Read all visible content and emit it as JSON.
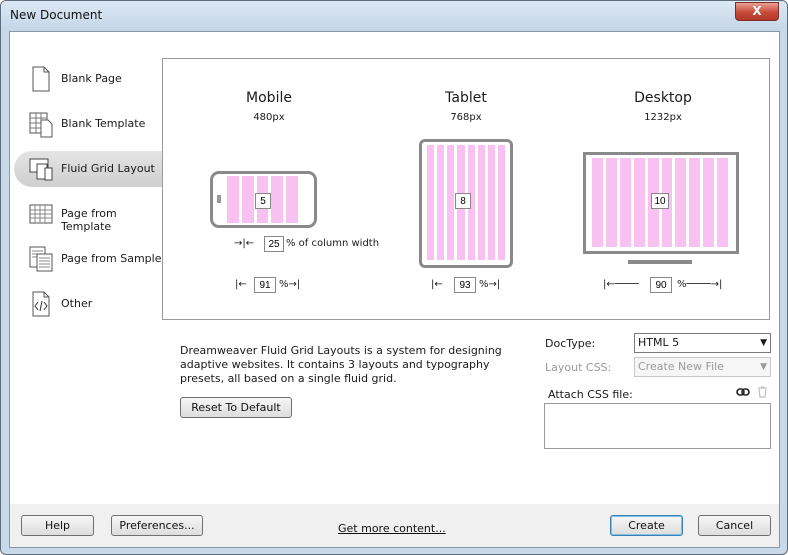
{
  "window": {
    "title": "New Document",
    "close_glyph": "X"
  },
  "sidebar": {
    "items": [
      {
        "label": "Blank Page",
        "icon": "blank-page-icon"
      },
      {
        "label": "Blank Template",
        "icon": "blank-template-icon"
      },
      {
        "label": "Fluid Grid Layout",
        "icon": "fluid-grid-icon",
        "selected": true
      },
      {
        "label": "Page from Template",
        "icon": "page-from-template-icon"
      },
      {
        "label": "Page from Sample",
        "icon": "page-from-sample-icon"
      },
      {
        "label": "Other",
        "icon": "other-code-icon"
      }
    ]
  },
  "preview": {
    "mobile": {
      "name": "Mobile",
      "px": "480px",
      "columns": "5",
      "width_pct": "91",
      "gutter_pct": "25",
      "gutter_label": "% of column width"
    },
    "tablet": {
      "name": "Tablet",
      "px": "768px",
      "columns": "8",
      "width_pct": "93"
    },
    "desktop": {
      "name": "Desktop",
      "px": "1232px",
      "columns": "10",
      "width_pct": "90"
    },
    "pct_sign": "%",
    "column_color": "#f9c0f2"
  },
  "description": "Dreamweaver Fluid Grid Layouts is a system for designing adaptive websites. It contains 3 layouts and typography presets, all based on a single fluid grid.",
  "reset_button": "Reset To Default",
  "form": {
    "doctype_label": "DocType:",
    "doctype_value": "HTML 5",
    "layout_css_label": "Layout CSS:",
    "layout_css_value": "Create New File",
    "attach_css_label": "Attach CSS file:"
  },
  "footer": {
    "help": "Help",
    "preferences": "Preferences...",
    "get_more": "Get more content...",
    "create": "Create",
    "cancel": "Cancel"
  }
}
